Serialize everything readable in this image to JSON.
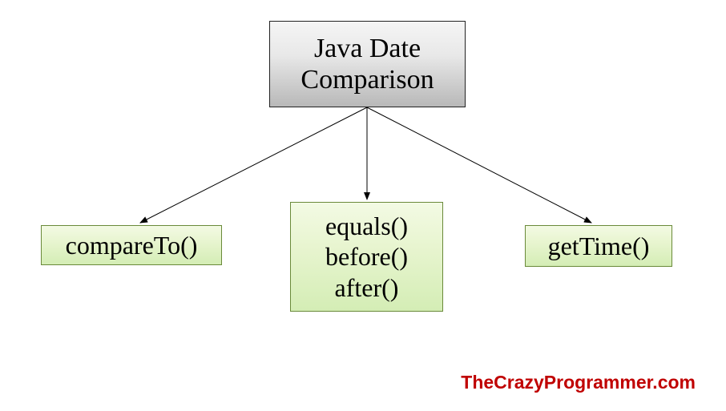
{
  "root": {
    "line1": "Java Date",
    "line2": "Comparison"
  },
  "leaves": {
    "left": "compareTo()",
    "center": {
      "line1": "equals()",
      "line2": "before()",
      "line3": "after()"
    },
    "right": "getTime()"
  },
  "watermark": "TheCrazyProgrammer.com"
}
